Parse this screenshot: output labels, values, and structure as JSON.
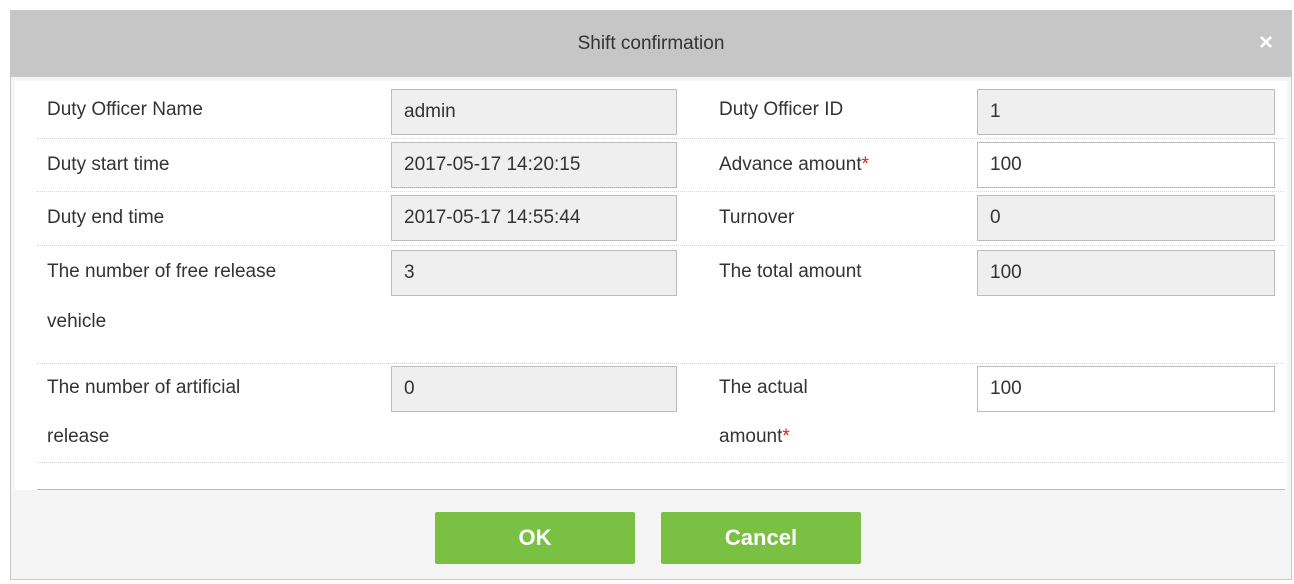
{
  "dialog": {
    "title": "Shift confirmation",
    "close_glyph": "×"
  },
  "form": {
    "rows": [
      {
        "left_label": "Duty Officer Name",
        "left_value": "admin",
        "right_label": "Duty Officer ID",
        "right_value": "1"
      },
      {
        "left_label": "Duty start time",
        "left_value": "2017-05-17 14:20:15",
        "right_label": "Advance amount",
        "right_value": "100"
      },
      {
        "left_label": "Duty end time",
        "left_value": "2017-05-17 14:55:44",
        "right_label": "Turnover",
        "right_value": "0"
      },
      {
        "left_label_line1": "The number of free release",
        "left_label_line2": "vehicle",
        "left_value": "3",
        "right_label": "The total amount",
        "right_value": "100"
      },
      {
        "left_label_line1": "The number of artificial",
        "left_label_line2": "release",
        "left_value": "0",
        "right_label_line1": "The actual",
        "right_label_line2": "amount",
        "right_value": "100"
      }
    ],
    "required_mark": "*"
  },
  "buttons": {
    "ok_label": "OK",
    "cancel_label": "Cancel"
  },
  "colors": {
    "titlebar": "#c6c6c6",
    "button_green": "#7ac143",
    "required_red": "#e0201b",
    "readonly_field": "#efefef"
  }
}
